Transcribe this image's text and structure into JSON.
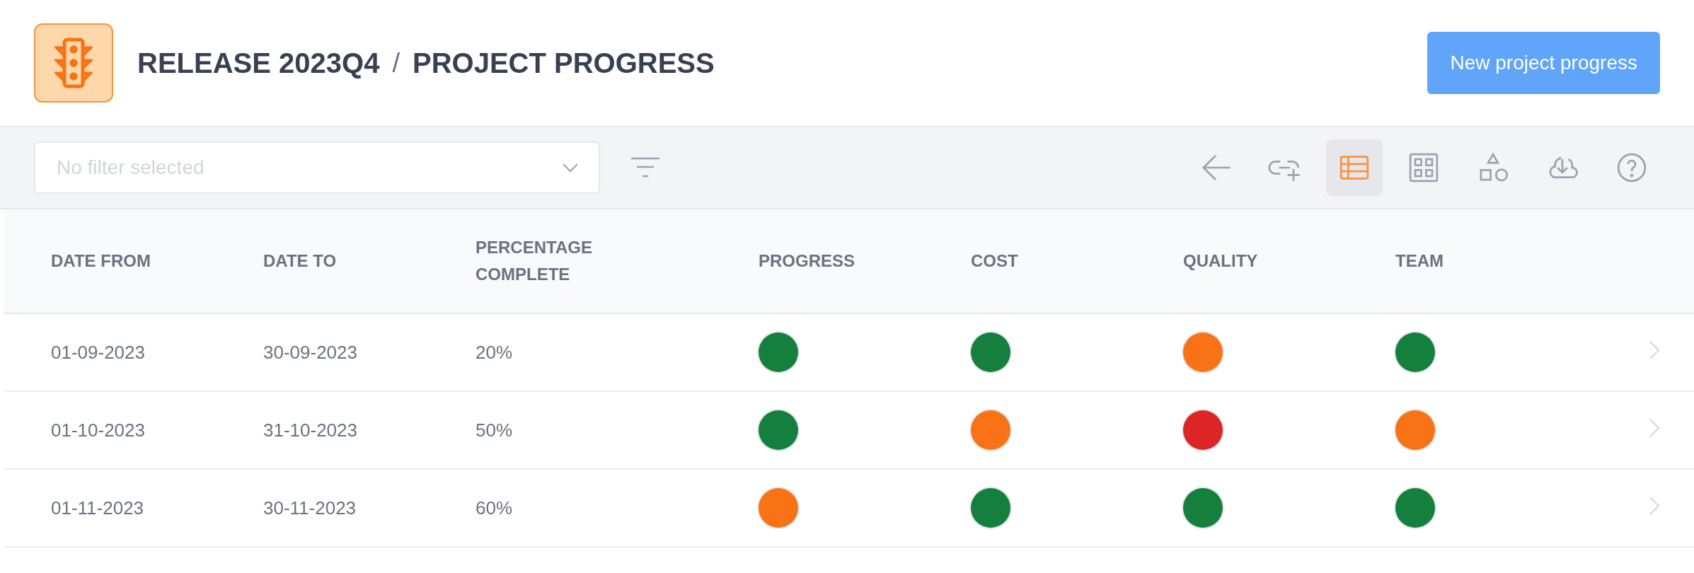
{
  "header": {
    "breadcrumb": [
      "RELEASE 2023Q4",
      "/",
      "PROJECT PROGRESS"
    ],
    "button": "New project progress"
  },
  "toolbar": {
    "filter": {
      "placeholder": "No filter selected"
    },
    "views": [
      {
        "kind": "back",
        "selected": false
      },
      {
        "kind": "link",
        "selected": false
      },
      {
        "kind": "table",
        "selected": true
      },
      {
        "kind": "grid",
        "selected": false
      },
      {
        "kind": "shapes",
        "selected": false
      },
      {
        "kind": "download",
        "selected": false
      },
      {
        "kind": "help",
        "selected": false
      }
    ]
  },
  "table": {
    "columns": [
      "DATE FROM",
      "DATE TO",
      "PERCENTAGE COMPLETE",
      "PROGRESS",
      "COST",
      "QUALITY",
      "TEAM"
    ],
    "rows": [
      {
        "date_from": "01-09-2023",
        "date_to": "30-09-2023",
        "percentage": "20%",
        "statuses": [
          {
            "color": "#15803d"
          },
          {
            "color": "#15803d"
          },
          {
            "color": "#f97316"
          },
          {
            "color": "#15803d"
          }
        ]
      },
      {
        "date_from": "01-10-2023",
        "date_to": "31-10-2023",
        "percentage": "50%",
        "statuses": [
          {
            "color": "#15803d"
          },
          {
            "color": "#f97316"
          },
          {
            "color": "#dc2626"
          },
          {
            "color": "#f97316"
          }
        ]
      },
      {
        "date_from": "01-11-2023",
        "date_to": "30-11-2023",
        "percentage": "60%",
        "statuses": [
          {
            "color": "#f97316"
          },
          {
            "color": "#15803d"
          },
          {
            "color": "#15803d"
          },
          {
            "color": "#15803d"
          }
        ]
      }
    ]
  }
}
